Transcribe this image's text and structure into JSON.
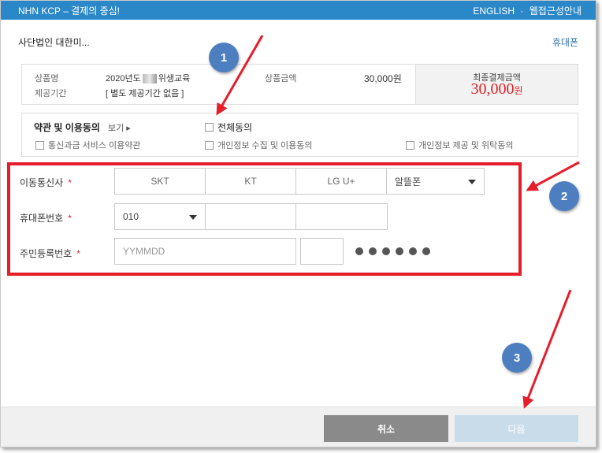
{
  "titlebar": {
    "title": "NHN KCP – 결제의 중심!",
    "english": "ENGLISH",
    "separator": "·",
    "accessibility": "웹접근성안내"
  },
  "merchant": {
    "name": "사단법인 대한미..."
  },
  "method_link": "휴대폰",
  "summary": {
    "product_label": "상품명",
    "product_value_prefix": "2020년도",
    "product_value_suffix": "위생교육",
    "period_label": "제공기간",
    "period_value": "[ 별도 제공기간 없음 ]",
    "price_label": "상품금액",
    "price_value": "30,000원",
    "total_label": "최종결제금액",
    "total_value": "30,000",
    "total_unit": "원"
  },
  "terms": {
    "heading": "약관 및 이용동의",
    "view": "보기 ▸",
    "agree_all": "전체동의",
    "items": [
      "통신과금 서비스 이용약관",
      "개인정보 수집 및 이용동의",
      "개인정보 제공 및 위탁동의"
    ]
  },
  "form": {
    "carrier_label": "이동통신사",
    "carriers": [
      "SKT",
      "KT",
      "LG U+"
    ],
    "mvno_select": "알뜰폰",
    "phone_label": "휴대폰번호",
    "phone_prefix": "010",
    "phone_mid": "",
    "phone_last": "",
    "ssn_label": "주민등록번호",
    "ssn_placeholder": "YYMMDD",
    "ssn_digit": "",
    "required_mark": "*"
  },
  "buttons": {
    "cancel": "취소",
    "next": "다음"
  },
  "annotations": {
    "badge1": "1",
    "badge2": "2",
    "badge3": "3"
  },
  "colors": {
    "brand": "#2b88c8",
    "highlight": "#e41e2a",
    "badge": "#4d7fc0",
    "total": "#e02020"
  }
}
